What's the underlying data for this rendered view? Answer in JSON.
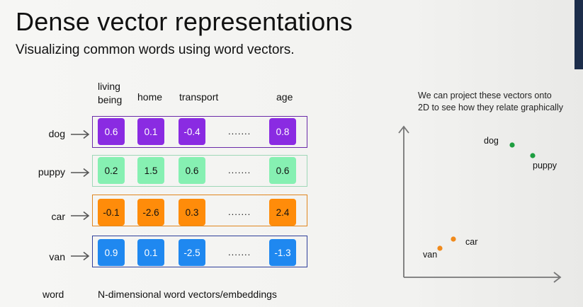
{
  "title": "Dense vector representations",
  "subtitle": "Visualizing common words using word vectors.",
  "headers": {
    "living_line1": "living",
    "living_line2": "being",
    "home": "home",
    "transport": "transport",
    "age": "age"
  },
  "rows": [
    {
      "word": "dog",
      "values": [
        "0.6",
        "0.1",
        "-0.4",
        "0.8"
      ],
      "dots": "......."
    },
    {
      "word": "puppy",
      "values": [
        "0.2",
        "1.5",
        "0.6",
        "0.6"
      ],
      "dots": "......."
    },
    {
      "word": "car",
      "values": [
        "-0.1",
        "-2.6",
        "0.3",
        "2.4"
      ],
      "dots": "......."
    },
    {
      "word": "van",
      "values": [
        "0.9",
        "0.1",
        "-2.5",
        "-1.3"
      ],
      "dots": "......."
    }
  ],
  "colors": {
    "dog": {
      "fill": "#8a2be2",
      "border": "#6a2aa8",
      "text": "#ffffff"
    },
    "puppy": {
      "fill": "#86f0b2",
      "border": "#9ed7b7",
      "text": "#111111"
    },
    "car": {
      "fill": "#ff8c0a",
      "border": "#e0861f",
      "text": "#111111"
    },
    "van": {
      "fill": "#1f88f0",
      "border": "#2f3f9a",
      "text": "#ffffff"
    }
  },
  "bottom": {
    "word_label": "word",
    "vectors_label": "N-dimensional word vectors/embeddings"
  },
  "projection": {
    "note_line1": "We can project these vectors onto",
    "note_line2": "2D to see how they relate graphically",
    "points": [
      {
        "label": "dog",
        "color": "#1e9e40"
      },
      {
        "label": "puppy",
        "color": "#1e9e40"
      },
      {
        "label": "car",
        "color": "#f08a1c"
      },
      {
        "label": "van",
        "color": "#f08a1c"
      }
    ]
  }
}
